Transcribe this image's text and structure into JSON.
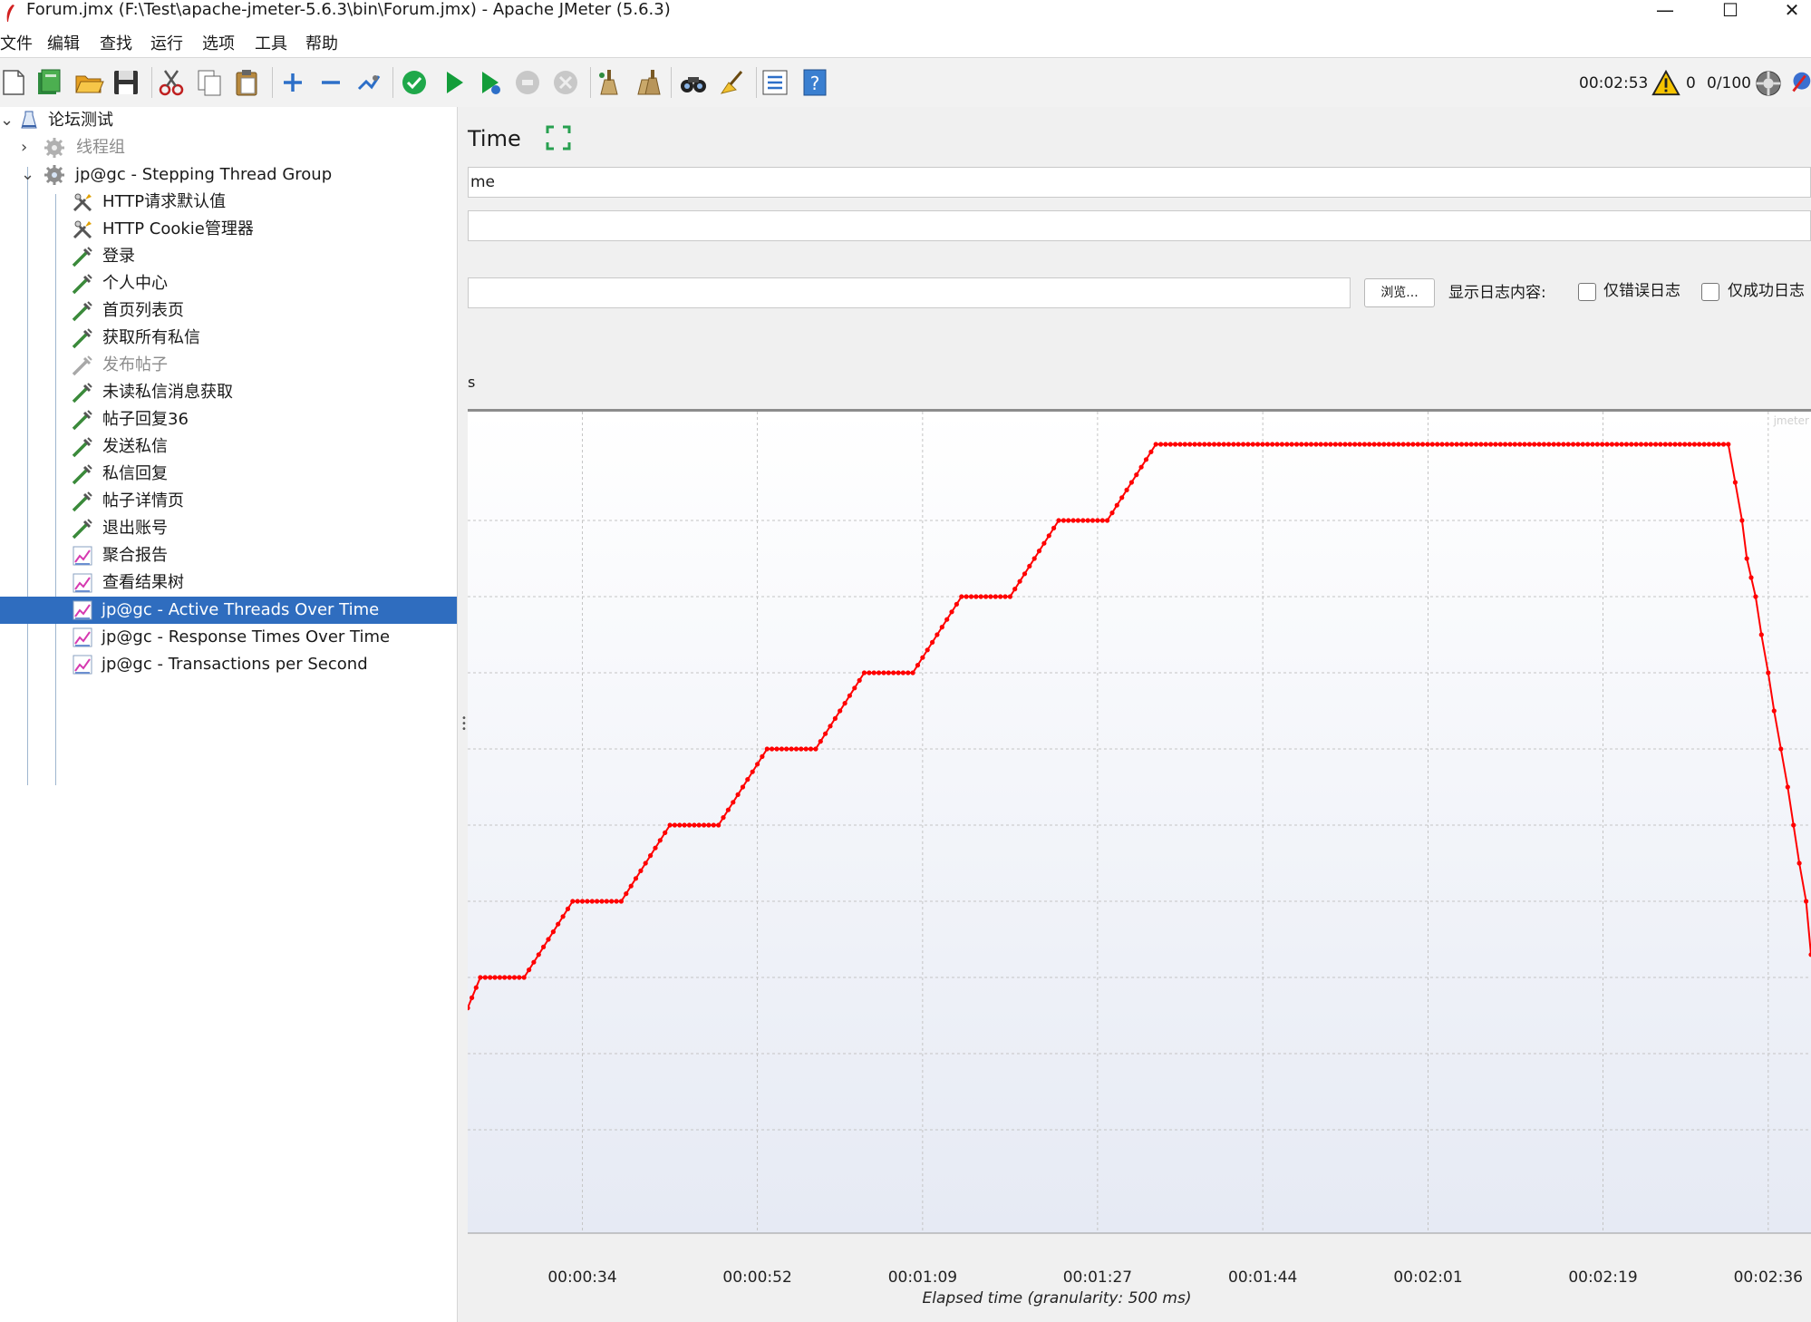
{
  "window": {
    "title": "Forum.jmx (F:\\Test\\apache-jmeter-5.6.3\\bin\\Forum.jmx) - Apache JMeter (5.6.3)",
    "minimize_glyph": "—",
    "maximize_glyph": "☐",
    "close_glyph": "✕"
  },
  "menu": [
    "文件",
    "编辑",
    "查找",
    "运行",
    "选项",
    "工具",
    "帮助"
  ],
  "toolbar": {
    "icons": [
      "new-icon",
      "templates-icon",
      "open-icon",
      "save-icon",
      "cut-icon",
      "copy-icon",
      "paste-icon",
      "expand-icon",
      "collapse-icon",
      "toggle-icon",
      "start-icon",
      "start-icon",
      "start-no-pause-icon",
      "stop-icon",
      "shutdown-icon",
      "clear-icon",
      "clear-all-icon",
      "search-icon",
      "reset-search-icon",
      "function-helper-icon",
      "help-icon"
    ],
    "elapsed": "00:02:53",
    "warning_count": "0",
    "threads": "0/100"
  },
  "tree": [
    {
      "label": "论坛测试",
      "icon": "test-plan-icon",
      "toggle": "expanded",
      "disabled": false,
      "selected": false
    },
    {
      "label": "线程组",
      "icon": "thread-group-icon",
      "toggle": "collapsed",
      "disabled": true,
      "selected": false
    },
    {
      "label": "jp@gc - Stepping Thread Group",
      "icon": "thread-group-icon",
      "toggle": "expanded",
      "disabled": false,
      "selected": false
    },
    {
      "label": "HTTP请求默认值",
      "icon": "config-element-icon",
      "disabled": false,
      "selected": false
    },
    {
      "label": "HTTP Cookie管理器",
      "icon": "config-element-icon",
      "disabled": false,
      "selected": false
    },
    {
      "label": "登录",
      "icon": "sampler-icon",
      "disabled": false,
      "selected": false
    },
    {
      "label": "个人中心",
      "icon": "sampler-icon",
      "disabled": false,
      "selected": false
    },
    {
      "label": "首页列表页",
      "icon": "sampler-icon",
      "disabled": false,
      "selected": false
    },
    {
      "label": "获取所有私信",
      "icon": "sampler-icon",
      "disabled": false,
      "selected": false
    },
    {
      "label": "发布帖子",
      "icon": "sampler-icon",
      "disabled": true,
      "selected": false
    },
    {
      "label": "未读私信消息获取",
      "icon": "sampler-icon",
      "disabled": false,
      "selected": false
    },
    {
      "label": "帖子回复36",
      "icon": "sampler-icon",
      "disabled": false,
      "selected": false
    },
    {
      "label": "发送私信",
      "icon": "sampler-icon",
      "disabled": false,
      "selected": false
    },
    {
      "label": "私信回复",
      "icon": "sampler-icon",
      "disabled": false,
      "selected": false
    },
    {
      "label": "帖子详情页",
      "icon": "sampler-icon",
      "disabled": false,
      "selected": false
    },
    {
      "label": "退出账号",
      "icon": "sampler-icon",
      "disabled": false,
      "selected": false
    },
    {
      "label": "聚合报告",
      "icon": "listener-icon",
      "disabled": false,
      "selected": false
    },
    {
      "label": "查看结果树",
      "icon": "listener-icon",
      "disabled": false,
      "selected": false
    },
    {
      "label": "jp@gc - Active Threads Over Time",
      "icon": "listener-icon",
      "disabled": false,
      "selected": true
    },
    {
      "label": "jp@gc - Response Times Over Time",
      "icon": "listener-icon",
      "disabled": false,
      "selected": false
    },
    {
      "label": "jp@gc - Transactions per Second",
      "icon": "listener-icon",
      "disabled": false,
      "selected": false
    }
  ],
  "panel": {
    "title": "Time",
    "name_value": "me",
    "comment_value": "",
    "file_value": "",
    "browse_label": "浏览...",
    "log_label": "显示日志内容:",
    "errors_only_label": "仅错误日志",
    "errors_only_checked": false,
    "success_only_label": "仅成功日志",
    "success_only_checked": false,
    "settings_tab": "s"
  },
  "colors": {
    "series": "#ff0000",
    "selection": "#2f6dbf",
    "plot_top": "#ffffff",
    "plot_bottom": "#e6eaf4"
  },
  "chart_data": {
    "type": "line",
    "xlabel": "Elapsed time (granularity: 500 ms)",
    "watermark": "jmeter",
    "x_unit": "elapsed seconds",
    "y_unit": "fraction of the plot height (no y labels are shown)",
    "x_ticks": [
      {
        "label": "00:00:34",
        "value": 34
      },
      {
        "label": "00:00:52",
        "value": 52
      },
      {
        "label": "00:01:09",
        "value": 69
      },
      {
        "label": "00:01:27",
        "value": 87
      },
      {
        "label": "00:01:44",
        "value": 104
      },
      {
        "label": "00:02:01",
        "value": 121
      },
      {
        "label": "00:02:19",
        "value": 139
      },
      {
        "label": "00:02:36",
        "value": 156
      }
    ],
    "xlim": [
      22.2,
      160.4
    ],
    "ylim": [
      0,
      1
    ],
    "grid": {
      "x": [
        34,
        52,
        69,
        87,
        104,
        121,
        139,
        156
      ],
      "y": [
        0.1,
        0.2,
        0.3,
        0.4,
        0.5,
        0.6,
        0.7,
        0.8,
        0.9
      ]
    },
    "series": [
      {
        "values": [
          [
            22.2,
            0.26
          ],
          [
            23.5,
            0.3
          ],
          [
            28.0,
            0.3
          ],
          [
            33.0,
            0.4
          ],
          [
            38.0,
            0.4
          ],
          [
            43.0,
            0.5
          ],
          [
            48.0,
            0.5
          ],
          [
            53.0,
            0.6
          ],
          [
            58.0,
            0.6
          ],
          [
            63.0,
            0.7
          ],
          [
            68.0,
            0.7
          ],
          [
            73.0,
            0.8
          ],
          [
            78.0,
            0.8
          ],
          [
            83.0,
            0.9
          ],
          [
            88.0,
            0.9
          ],
          [
            93.0,
            1.0
          ],
          [
            151.9,
            1.0
          ],
          [
            152.6,
            0.95
          ],
          [
            153.3,
            0.9
          ],
          [
            153.8,
            0.85
          ],
          [
            154.7,
            0.8
          ],
          [
            155.3,
            0.75
          ],
          [
            156.0,
            0.7
          ],
          [
            156.6,
            0.65
          ],
          [
            157.3,
            0.6
          ],
          [
            158.0,
            0.55
          ],
          [
            158.6,
            0.5
          ],
          [
            159.2,
            0.45
          ],
          [
            159.9,
            0.4
          ],
          [
            160.4,
            0.33
          ]
        ]
      }
    ]
  }
}
